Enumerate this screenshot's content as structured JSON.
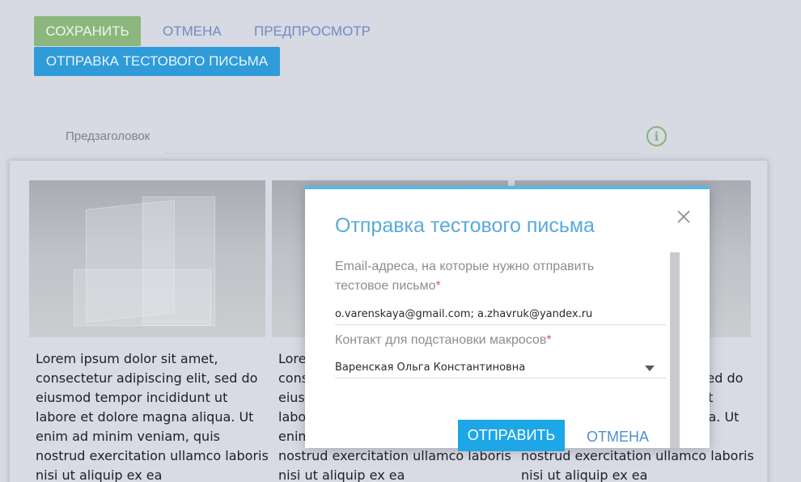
{
  "toolbar": {
    "save_label": "СОХРАНИТЬ",
    "cancel_label": "ОТМЕНА",
    "preview_label": "ПРЕДПРОСМОТР",
    "send_test_label": "ОТПРАВКА ТЕСТОВОГО ПИСЬМА"
  },
  "preheader": {
    "label": "Предзаголовок",
    "info_icon": "info-icon"
  },
  "content": {
    "columns": [
      {
        "text": "Lorem ipsum dolor sit amet, consectetur adipiscing elit, sed do eiusmod tempor incididunt ut labore et dolore magna aliqua. Ut enim ad minim veniam, quis nostrud exercitation ullamco laboris nisi ut aliquip ex ea"
      },
      {
        "text": "Lorem ipsum dolor sit amet, consectetur adipiscing elit, sed do eiusmod tempor incididunt ut labore et dolore magna aliqua. Ut enim ad minim veniam, quis nostrud exercitation ullamco laboris nisi ut aliquip ex ea"
      },
      {
        "text": "Lorem ipsum dolor sit amet, consectetur adipiscing elit, sed do eiusmod tempor incididunt ut labore et dolore magna aliqua. Ut enim ad minim veniam, quis nostrud exercitation ullamco laboris nisi ut aliquip ex ea"
      }
    ]
  },
  "modal": {
    "title": "Отправка тестового письма",
    "email_label_line1": "Email-адреса, на которые нужно отправить",
    "email_label_line2": "тестовое письмо",
    "email_value": "o.varenskaya@gmail.com; a.zhavruk@yandex.ru",
    "contact_label": "Контакт для подстановки макросов",
    "contact_value": "Варенская Ольга Константиновна",
    "required_mark": "*",
    "send_label": "ОТПРАВИТЬ",
    "cancel_label": "ОТМЕНА"
  },
  "colors": {
    "save_button": "#8bb77e",
    "test_button": "#2f9bd9",
    "modal_accent": "#5ab7e6",
    "send_button": "#1ea7e6",
    "required": "#e05a5a"
  }
}
